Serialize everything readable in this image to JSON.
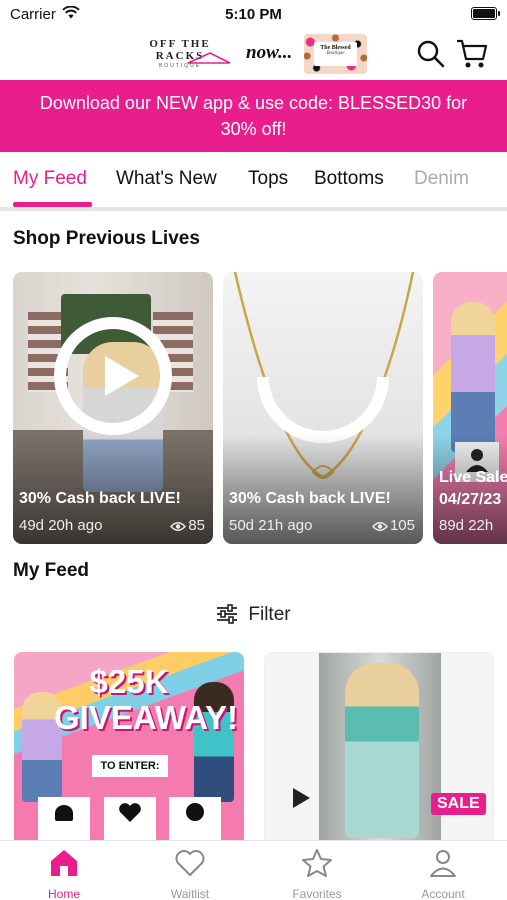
{
  "status_bar": {
    "carrier": "Carrier",
    "time": "5:10 PM"
  },
  "header": {
    "logo_main": "OFF THE RACKS",
    "logo_main_sub": "BOUTIQUE",
    "logo_now": "now...",
    "logo_badge_line1": "The Blessed",
    "logo_badge_line2": "Boutique"
  },
  "promo": {
    "line1": "Download our NEW app & use code: BLESSED30 for",
    "line2": "30% off!"
  },
  "tabs": [
    "My Feed",
    "What's New",
    "Tops",
    "Bottoms",
    "Denim"
  ],
  "previous_lives": {
    "title": "Shop Previous Lives",
    "cards": [
      {
        "title": "30% Cash back LIVE!",
        "ago": "49d 20h ago",
        "views": "85"
      },
      {
        "title": "30% Cash back LIVE!",
        "ago": "50d 21h ago",
        "views": "105"
      },
      {
        "title": "Live Sale 04/27/23",
        "title_line2": "04/27/23",
        "ago": "89d 22h"
      }
    ]
  },
  "feed": {
    "title": "My Feed",
    "filter_label": "Filter",
    "items": [
      {
        "headline1": "$25K",
        "headline2": "GIVEAWAY!",
        "enter_label": "TO ENTER:"
      },
      {
        "badge": "SALE"
      }
    ]
  },
  "bottom_nav": [
    "Home",
    "Waitlist",
    "Favorites",
    "Account"
  ],
  "colors": {
    "accent": "#e91e8c"
  }
}
